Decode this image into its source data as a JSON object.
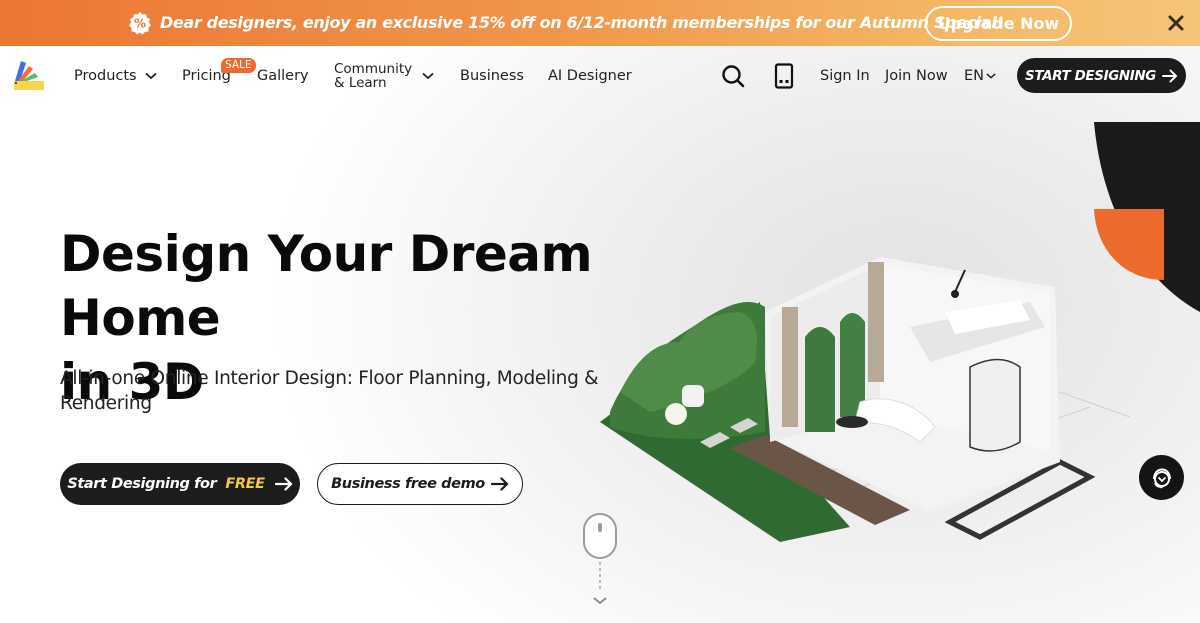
{
  "promo": {
    "badge_icon": "percent-badge-icon",
    "text": "Dear designers, enjoy an exclusive 15% off on 6/12-month memberships for our Autumn Special!",
    "button_label": "Upgrade Now",
    "close_icon": "close-icon",
    "colors": {
      "gradient_start": "#ec7634",
      "gradient_end": "#f5c57a"
    }
  },
  "nav": {
    "logo_icon": "color-swatch-fan-logo",
    "items": [
      {
        "label": "Products",
        "has_dropdown": true
      },
      {
        "label": "Pricing",
        "badge": "SALE"
      },
      {
        "label": "Gallery"
      },
      {
        "label_line1": "Community",
        "label_line2": "& Learn",
        "has_dropdown": true
      },
      {
        "label": "Business"
      },
      {
        "label": "AI Designer"
      }
    ],
    "search_icon": "search-icon",
    "device_icon": "tablet-icon",
    "sign_in": "Sign In",
    "join_now": "Join Now",
    "language": "EN",
    "cta_label": "START DESIGNING",
    "colors": {
      "sale_badge": "#ec6a2c",
      "cta_bg": "#1c1c1c"
    }
  },
  "hero": {
    "title_line1": "Design Your Dream Home",
    "title_line2": "in 3D",
    "subtitle": "All-in-one Online Interior Design: Floor Planning, Modeling & Rendering",
    "primary_cta": {
      "text": "Start Designing for",
      "highlight": "FREE"
    },
    "secondary_cta": "Business free demo",
    "scroll_icon": "mouse-scroll-icon",
    "illustration": "3d-house-render",
    "colors": {
      "highlight": "#f5c842",
      "accent_orange": "#ec6a2c",
      "dark": "#1c1c1c"
    }
  },
  "support": {
    "icon": "headset-support-icon"
  }
}
